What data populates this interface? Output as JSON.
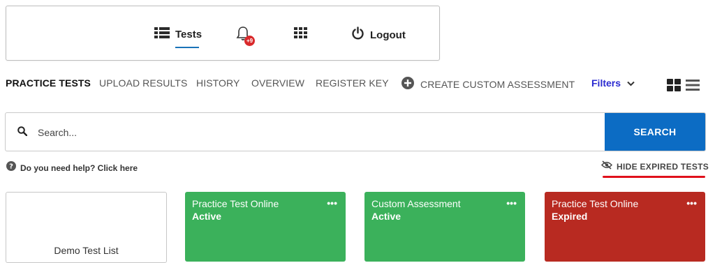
{
  "colors": {
    "accent_blue": "#0c6cc4",
    "filters_blue": "#2a2ad0",
    "active_green": "#3bb15b",
    "expired_red": "#b82a21",
    "badge_red": "#d9292b",
    "underline_red": "#e0101b"
  },
  "header": {
    "tests_label": "Tests",
    "tests_icon": "list-icon",
    "notifications_icon": "bell-icon",
    "notifications_badge": "+9",
    "apps_icon": "grid-icon",
    "logout_icon": "power-icon",
    "logout_label": "Logout"
  },
  "nav": {
    "items": [
      {
        "label": "PRACTICE TESTS",
        "active": true
      },
      {
        "label": "UPLOAD RESULTS"
      },
      {
        "label": "HISTORY"
      },
      {
        "label": "OVERVIEW"
      },
      {
        "label": "REGISTER KEY"
      }
    ],
    "create_icon": "plus-circle-icon",
    "create_label": "CREATE CUSTOM ASSESSMENT",
    "filters_label": "Filters",
    "view_grid_icon": "grid-view-icon",
    "view_list_icon": "list-view-icon"
  },
  "search": {
    "placeholder": "Search...",
    "value": "",
    "button_label": "SEARCH"
  },
  "help": {
    "icon": "question-circle-icon",
    "label": "Do you need help? Click here"
  },
  "hide_expired": {
    "icon": "eye-slash-icon",
    "label": "HIDE EXPIRED TESTS"
  },
  "cards": [
    {
      "kind": "list",
      "title": "Demo Test List"
    },
    {
      "kind": "test",
      "type": "Practice Test Online",
      "status": "Active",
      "color": "#3bb15b",
      "menu": "•••"
    },
    {
      "kind": "test",
      "type": "Custom Assessment",
      "status": "Active",
      "color": "#3bb15b",
      "menu": "•••"
    },
    {
      "kind": "test",
      "type": "Practice Test Online",
      "status": "Expired",
      "color": "#b82a21",
      "menu": "•••"
    }
  ]
}
